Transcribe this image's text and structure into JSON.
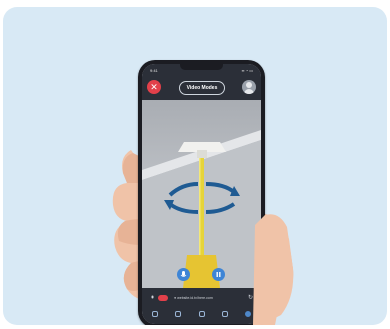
{
  "status_bar": {
    "time": "9:41",
    "icons": "▪▪ ◔ ▭"
  },
  "top_bar": {
    "close_glyph": "✕",
    "mode_label": "Video Modes"
  },
  "bottom_bar": {
    "url": "● website.id.tv/here.com",
    "reload_glyph": "↻"
  },
  "icons": [
    "close-icon",
    "avatar-icon",
    "rotate-arrows-icon",
    "mic-icon",
    "pause-icon",
    "reload-icon"
  ],
  "colors": {
    "card_bg": "#d8e9f5",
    "accent_red": "#e2404a",
    "accent_blue": "#3e85d6",
    "pole_yellow": "#e6d43a"
  }
}
